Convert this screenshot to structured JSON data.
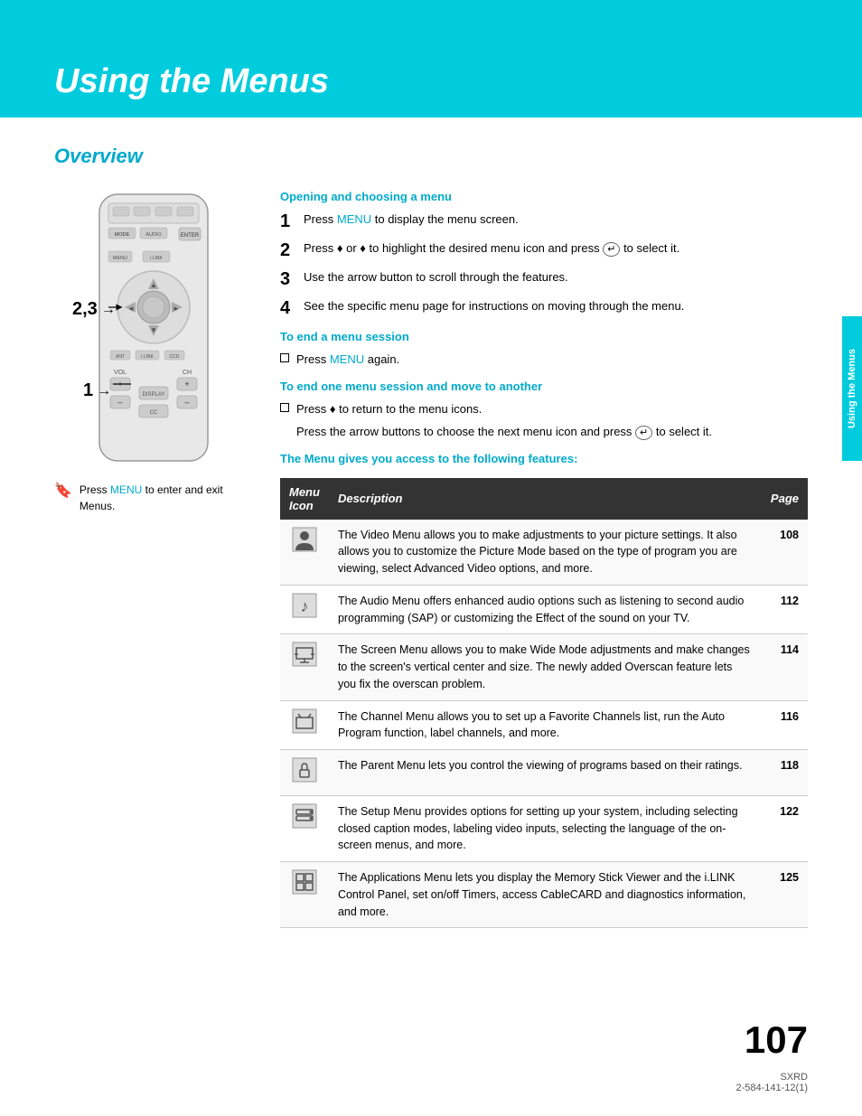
{
  "header": {
    "title": "Using the Menus",
    "background_color": "#00ccdd"
  },
  "side_tab": {
    "text": "Using the Menus"
  },
  "overview": {
    "heading": "Overview",
    "opening_section": {
      "heading": "Opening and choosing a menu",
      "steps": [
        {
          "number": "1",
          "text_parts": [
            "Press ",
            "MENU",
            " to display the menu screen."
          ]
        },
        {
          "number": "2",
          "text_parts": [
            "Press ♦ or ♦ to highlight the desired menu icon and press ",
            "⊙",
            " to select it."
          ]
        },
        {
          "number": "3",
          "text_parts": [
            "Use the arrow button to scroll through the features."
          ]
        },
        {
          "number": "4",
          "text_parts": [
            "See the specific menu page for instructions on moving through the menu."
          ]
        }
      ]
    },
    "end_session": {
      "heading": "To end a menu session",
      "items": [
        {
          "text_parts": [
            "Press ",
            "MENU",
            " again."
          ]
        }
      ]
    },
    "end_move_session": {
      "heading": "To end one menu session and move to another",
      "items": [
        {
          "text_parts": [
            "Press ♦ to return to the menu icons."
          ]
        },
        {
          "text_parts": [
            "Press the arrow buttons to choose the next menu icon and press ",
            "⊙",
            " to select it."
          ]
        }
      ]
    },
    "table_heading": "The Menu gives you access to the following features:",
    "table": {
      "columns": [
        "Menu Icon",
        "Description",
        "Page"
      ],
      "rows": [
        {
          "icon": "👤",
          "description": "The Video Menu allows you to make adjustments to your picture settings. It also allows you to customize the Picture Mode based on the type of program you are viewing, select Advanced Video options, and more.",
          "page": "108"
        },
        {
          "icon": "♪",
          "description": "The Audio Menu offers enhanced audio options such as listening to second audio programming (SAP) or customizing the Effect of the sound on your TV.",
          "page": "112"
        },
        {
          "icon": "▣",
          "description": "The Screen Menu allows you to make Wide Mode adjustments and make changes to the screen's vertical center and size. The newly added Overscan feature lets you fix the overscan problem.",
          "page": "114"
        },
        {
          "icon": "📺",
          "description": "The Channel Menu allows you to set up a Favorite Channels list, run the Auto Program function, label channels, and more.",
          "page": "116"
        },
        {
          "icon": "🔒",
          "description": "The Parent Menu lets you control the viewing of programs based on their ratings.",
          "page": "118"
        },
        {
          "icon": "🖥",
          "description": "The Setup Menu provides options for setting up your system, including selecting closed caption modes, labeling video inputs, selecting the language of the on-screen menus, and more.",
          "page": "122"
        },
        {
          "icon": "⊞",
          "description": "The Applications Menu lets you display the Memory Stick Viewer and the i.LINK Control Panel, set on/off Timers, access CableCARD and diagnostics information, and more.",
          "page": "125"
        }
      ]
    }
  },
  "press_menu_note": {
    "icon": "🔖",
    "text_parts": [
      "Press ",
      "MENU",
      " to enter and exit Menus."
    ]
  },
  "remote_labels": {
    "label_23": "2,3",
    "label_1": "1"
  },
  "page_number": "107",
  "footer": {
    "line1": "SXRD",
    "line2": "2-584-141-12(1)"
  }
}
